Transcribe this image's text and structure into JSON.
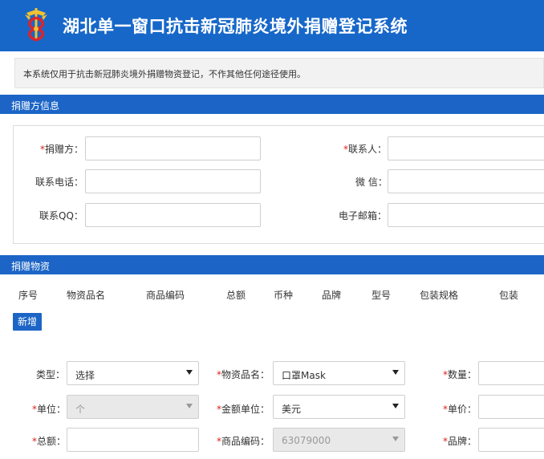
{
  "header": {
    "title": "湖北单一窗口抗击新冠肺炎境外捐赠登记系统",
    "logo_icon": "customs-emblem-icon"
  },
  "notice": "本系统仅用于抗击新冠肺炎境外捐赠物资登记，不作其他任何途径使用。",
  "donor_section": {
    "title": "捐赠方信息",
    "fields": {
      "donor": {
        "required_mark": "*",
        "label": "捐赠方：",
        "value": ""
      },
      "contact": {
        "required_mark": "*",
        "label": "联系人：",
        "value": ""
      },
      "phone": {
        "label": "联系电话：",
        "value": ""
      },
      "wechat": {
        "label": "微 信：",
        "value": ""
      },
      "qq": {
        "label": "联系QQ：",
        "value": ""
      },
      "email": {
        "label": "电子邮箱：",
        "value": ""
      }
    }
  },
  "goods_section": {
    "title": "捐赠物资",
    "columns": [
      "序号",
      "物资品名",
      "商品编码",
      "总额",
      "币种",
      "品牌",
      "型号",
      "包装规格",
      "包装"
    ],
    "add_button": "新增",
    "form": {
      "type": {
        "label": "类型：",
        "value": "选择"
      },
      "goods_name": {
        "required_mark": "*",
        "label": "物资品名：",
        "value": "口罩Mask"
      },
      "quantity": {
        "required_mark": "*",
        "label": "数量：",
        "value": ""
      },
      "unit": {
        "required_mark": "*",
        "label": "单位：",
        "value": "个"
      },
      "currency": {
        "required_mark": "*",
        "label": "金额单位：",
        "value": "美元"
      },
      "unit_price": {
        "required_mark": "*",
        "label": "单价：",
        "value": ""
      },
      "total": {
        "required_mark": "*",
        "label": "总额：",
        "value": ""
      },
      "hs_code": {
        "required_mark": "*",
        "label": "商品编码：",
        "value": "63079000"
      },
      "brand": {
        "required_mark": "*",
        "label": "品牌：",
        "value": ""
      }
    }
  },
  "colors": {
    "primary": "#1c65c6",
    "header": "#1767c9",
    "required": "#e02020"
  }
}
